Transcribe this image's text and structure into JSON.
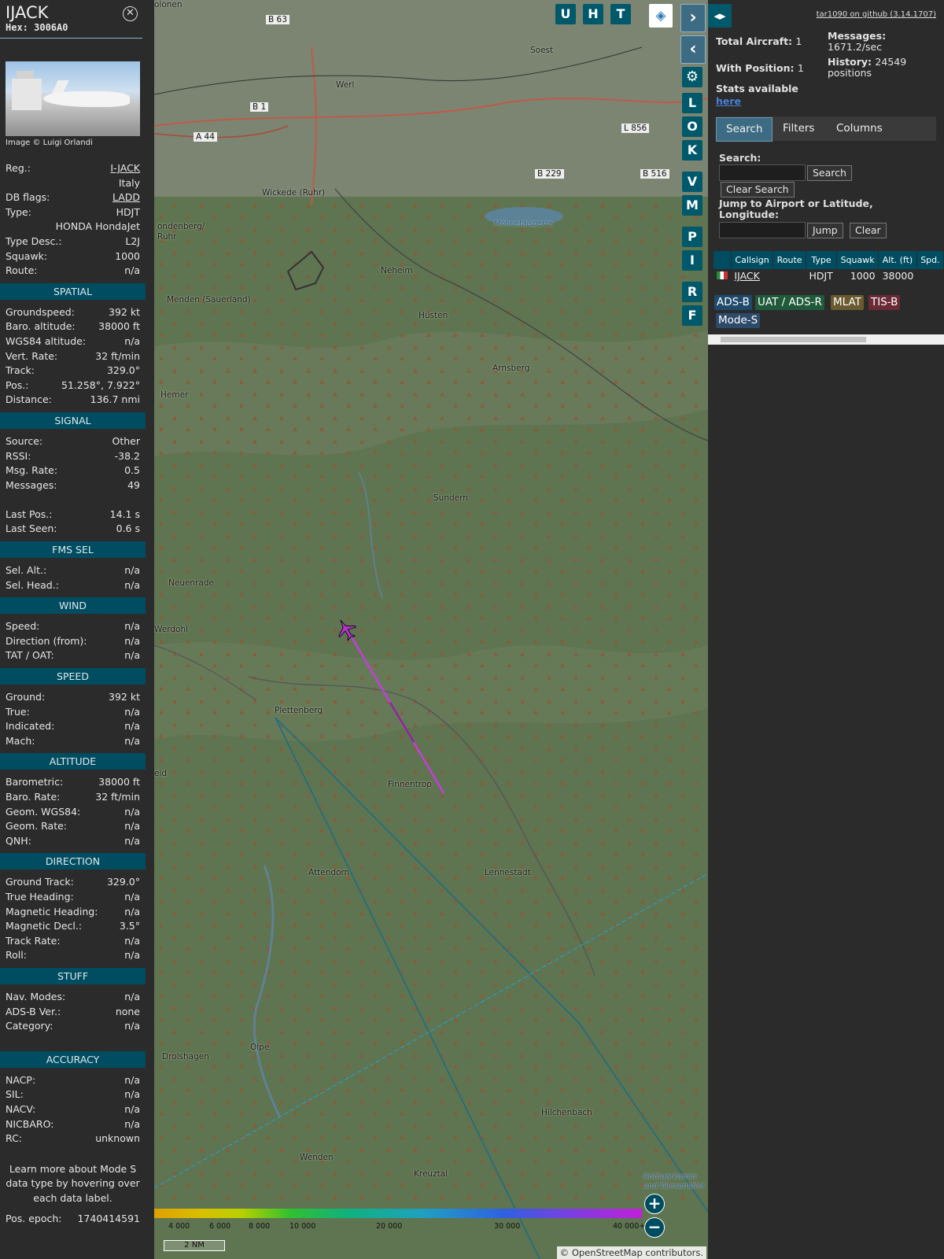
{
  "aircraft": {
    "callsign": "IJACK",
    "hex_label": "Hex: 3006A0",
    "image_credit": "Image © Luigi Orlandi"
  },
  "ident_rows": [
    {
      "label": "Reg.:",
      "value": "I-JACK",
      "link": true
    },
    {
      "label": "",
      "value": "Italy",
      "link": false
    },
    {
      "label": "DB flags:",
      "value": "LADD",
      "link": true
    },
    {
      "label": "Type:",
      "value": "HDJT",
      "link": false
    },
    {
      "label": "",
      "value": "HONDA HondaJet",
      "link": false
    },
    {
      "label": "Type Desc.:",
      "value": "L2J",
      "link": false
    },
    {
      "label": "Squawk:",
      "value": "1000",
      "link": false
    },
    {
      "label": "Route:",
      "value": "n/a",
      "link": false
    }
  ],
  "sections": [
    {
      "title": "SPATIAL",
      "rows": [
        {
          "label": "Groundspeed:",
          "value": "392 kt"
        },
        {
          "label": "Baro. altitude:",
          "value": "38000 ft"
        },
        {
          "label": "WGS84 altitude:",
          "value": "n/a"
        },
        {
          "label": "Vert. Rate:",
          "value": "32 ft/min"
        },
        {
          "label": "Track:",
          "value": "329.0°"
        },
        {
          "label": "Pos.:",
          "value": "51.258°, 7.922°"
        },
        {
          "label": "Distance:",
          "value": "136.7 nmi"
        }
      ]
    },
    {
      "title": "SIGNAL",
      "rows": [
        {
          "label": "Source:",
          "value": "Other"
        },
        {
          "label": "RSSI:",
          "value": "-38.2"
        },
        {
          "label": "Msg. Rate:",
          "value": "0.5"
        },
        {
          "label": "Messages:",
          "value": "49"
        },
        {
          "label": "",
          "value": ""
        },
        {
          "label": "Last Pos.:",
          "value": "14.1 s"
        },
        {
          "label": "Last Seen:",
          "value": "0.6 s"
        }
      ]
    },
    {
      "title": "FMS SEL",
      "rows": [
        {
          "label": "Sel. Alt.:",
          "value": "n/a"
        },
        {
          "label": "Sel. Head.:",
          "value": "n/a"
        }
      ]
    },
    {
      "title": "WIND",
      "rows": [
        {
          "label": "Speed:",
          "value": "n/a"
        },
        {
          "label": "Direction (from):",
          "value": "n/a"
        },
        {
          "label": "TAT / OAT:",
          "value": "n/a"
        }
      ]
    },
    {
      "title": "SPEED",
      "rows": [
        {
          "label": "Ground:",
          "value": "392 kt"
        },
        {
          "label": "True:",
          "value": "n/a"
        },
        {
          "label": "Indicated:",
          "value": "n/a"
        },
        {
          "label": "Mach:",
          "value": "n/a"
        }
      ]
    },
    {
      "title": "ALTITUDE",
      "rows": [
        {
          "label": "Barometric:",
          "value": "38000 ft"
        },
        {
          "label": "Baro. Rate:",
          "value": "32 ft/min"
        },
        {
          "label": "Geom. WGS84:",
          "value": "n/a"
        },
        {
          "label": "Geom. Rate:",
          "value": "n/a"
        },
        {
          "label": "QNH:",
          "value": "n/a"
        }
      ]
    },
    {
      "title": "DIRECTION",
      "rows": [
        {
          "label": "Ground Track:",
          "value": "329.0°"
        },
        {
          "label": "True Heading:",
          "value": "n/a"
        },
        {
          "label": "Magnetic Heading:",
          "value": "n/a"
        },
        {
          "label": "Magnetic Decl.:",
          "value": "3.5°"
        },
        {
          "label": "Track Rate:",
          "value": "n/a"
        },
        {
          "label": "Roll:",
          "value": "n/a"
        }
      ]
    },
    {
      "title": "STUFF",
      "rows": [
        {
          "label": "Nav. Modes:",
          "value": "n/a"
        },
        {
          "label": "ADS-B Ver.:",
          "value": "none"
        },
        {
          "label": "Category:",
          "value": "n/a"
        }
      ]
    }
  ],
  "accuracy": {
    "title": "ACCURACY",
    "rows": [
      {
        "label": "NACP:",
        "value": "n/a"
      },
      {
        "label": "SIL:",
        "value": "n/a"
      },
      {
        "label": "NACV:",
        "value": "n/a"
      },
      {
        "label": "NICBARO:",
        "value": "n/a"
      },
      {
        "label": "RC:",
        "value": "unknown"
      }
    ]
  },
  "learn_more": "Learn more about Mode S data type by hovering over each data label.",
  "pos_epoch": {
    "label": "Pos. epoch:",
    "value": "1740414591"
  },
  "map": {
    "places": [
      "Soest",
      "Werl",
      "Wickede (Ruhr)",
      "ondenberg/ Ruhr",
      "Neheim",
      "Menden (Sauerland)",
      "Hüsten",
      "Arnsberg",
      "Hemer",
      "Sundern",
      "Neuenrade",
      "Werdohl",
      "Plettenberg",
      "Finnentrop",
      "eid",
      "Attendorn",
      "Lennestadt",
      "Olpe",
      "Drolshagen",
      "Hilchenbach",
      "Wenden",
      "Kreuztal",
      "Möhnetalsperre",
      "Rothaarkamm und Wiesentäler",
      "olonen"
    ],
    "roads": [
      "B 63",
      "B 1",
      "A 44",
      "L 856",
      "B 229",
      "B 516"
    ],
    "toggles_top": [
      "U",
      "H",
      "T"
    ],
    "toggles_side": [
      "L",
      "O",
      "K",
      "V",
      "M",
      "P",
      "I",
      "R",
      "F"
    ],
    "zoom_in": "+",
    "zoom_out": "−",
    "legend_labels": [
      "4 000",
      "6 000",
      "8 000",
      "10 000",
      "20 000",
      "30 000",
      "40 000+"
    ],
    "scale": "2 NM",
    "attribution_prefix": "© ",
    "attribution_link": "OpenStreetMap",
    "attribution_suffix": " contributors."
  },
  "side": {
    "version": "tar1090 on github (3.14.1707)",
    "total_aircraft_label": "Total Aircraft:",
    "total_aircraft": "1",
    "with_position_label": "With Position:",
    "with_position": "1",
    "messages_label": "Messages:",
    "messages": "1671.2/sec",
    "history_label": "History:",
    "history": "24549 positions",
    "stats_label": "Stats available",
    "stats_link": "here",
    "tabs": [
      "Search",
      "Filters",
      "Columns"
    ],
    "search_label": "Search:",
    "search_button": "Search",
    "clear_search_button": "Clear Search",
    "jump_label": "Jump to Airport or Latitude, Longitude:",
    "jump_button": "Jump",
    "clear_button": "Clear",
    "table": {
      "columns": [
        "",
        "Callsign",
        "Route",
        "Type",
        "Squawk",
        "Alt. (ft)",
        "Spd."
      ],
      "rows": [
        [
          "",
          "IJACK",
          "",
          "HDJT",
          "1000",
          "38000",
          ""
        ]
      ]
    },
    "sources": [
      {
        "label": "ADS-B",
        "color": "#1f4a6b"
      },
      {
        "label": "UAT / ADS-R",
        "color": "#1f5a3a"
      },
      {
        "label": "MLAT",
        "color": "#6b5a2e"
      },
      {
        "label": "TIS-B",
        "color": "#6a2a36"
      },
      {
        "label": "Mode-S",
        "color": "#2e4a6b"
      }
    ]
  }
}
